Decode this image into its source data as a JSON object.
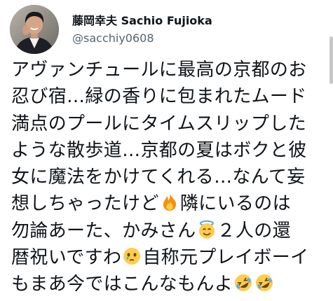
{
  "tweet": {
    "display_name": "藤岡幸夫 Sachio Fujioka",
    "handle": "@sacchiy0608",
    "lines": [
      "アヴァンチュールに最高の京都のお",
      "忍び宿…緑の香りに包まれたムード",
      "満点のプールにタイムスリップした",
      "ような散歩道…京都の夏はボクと彼",
      "女に魔法をかけてくれる…なんて妄",
      "想しちゃったけど",
      "隣にいるのは",
      "勿論あーた、かみさん",
      "２人の還",
      "暦祝いですわ",
      "自称元プレイボーイ",
      "もまあ今ではこんなもんよ"
    ],
    "emoji": {
      "fire": "fire-emoji",
      "halo": "smiling-face-with-halo-emoji",
      "tear": "face-holding-back-tears-emoji",
      "rofl": "rolling-on-the-floor-laughing-emoji"
    },
    "colors": {
      "text": "#0f1419",
      "handle": "#536471"
    }
  }
}
